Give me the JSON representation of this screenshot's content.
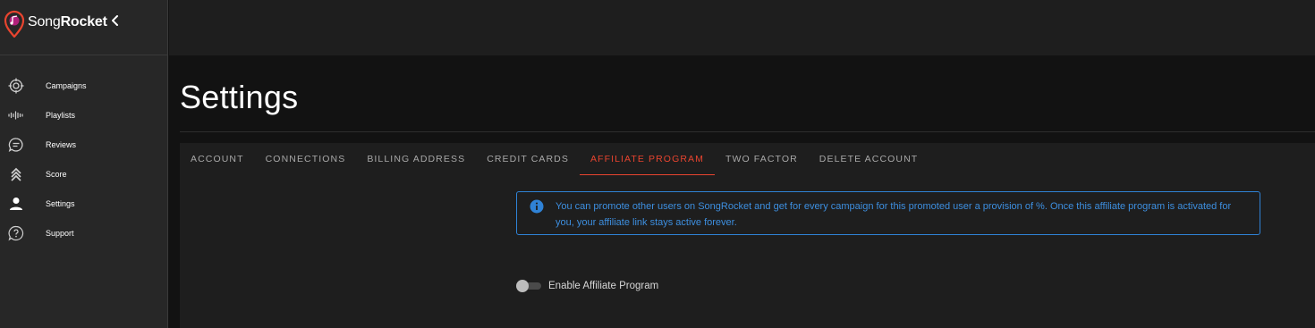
{
  "brand": {
    "name_light": "Song",
    "name_bold": "Rocket"
  },
  "sidebar": {
    "items": [
      {
        "label": "Campaigns",
        "icon": "target-icon"
      },
      {
        "label": "Playlists",
        "icon": "waveform-icon"
      },
      {
        "label": "Reviews",
        "icon": "chat-icon"
      },
      {
        "label": "Score",
        "icon": "chevrons-up-icon"
      },
      {
        "label": "Settings",
        "icon": "user-icon"
      },
      {
        "label": "Support",
        "icon": "help-icon"
      }
    ]
  },
  "page": {
    "title": "Settings"
  },
  "tabs": [
    {
      "label": "ACCOUNT",
      "active": false
    },
    {
      "label": "CONNECTIONS",
      "active": false
    },
    {
      "label": "BILLING ADDRESS",
      "active": false
    },
    {
      "label": "CREDIT CARDS",
      "active": false
    },
    {
      "label": "AFFILIATE PROGRAM",
      "active": true
    },
    {
      "label": "TWO FACTOR",
      "active": false
    },
    {
      "label": "DELETE ACCOUNT",
      "active": false
    }
  ],
  "affiliate": {
    "info_text": "You can promote other users on SongRocket and get for every campaign for this promoted user a provision of %. Once this affiliate program is activated for you, your affiliate link stays active forever.",
    "toggle_label": "Enable Affiliate Program",
    "enabled": false
  },
  "colors": {
    "accent": "#e8442f",
    "info": "#2f82d6",
    "sidebar_bg": "#272727",
    "page_bg": "#121212",
    "card_bg": "#1e1e1e"
  }
}
